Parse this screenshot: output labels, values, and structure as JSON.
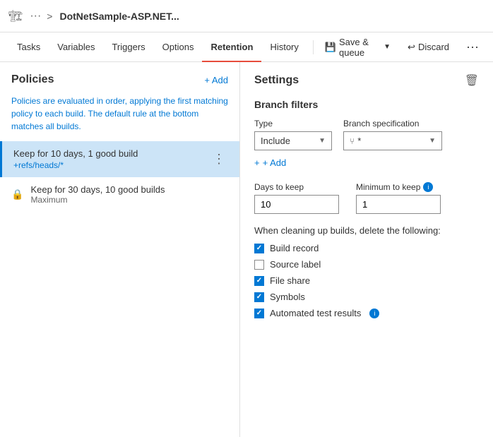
{
  "header": {
    "icon": "🏗",
    "dots": "···",
    "arrow": ">",
    "title": "DotNetSample-ASP.NET..."
  },
  "nav": {
    "items": [
      {
        "id": "tasks",
        "label": "Tasks",
        "active": false
      },
      {
        "id": "variables",
        "label": "Variables",
        "active": false
      },
      {
        "id": "triggers",
        "label": "Triggers",
        "active": false
      },
      {
        "id": "options",
        "label": "Options",
        "active": false
      },
      {
        "id": "retention",
        "label": "Retention",
        "active": true
      },
      {
        "id": "history",
        "label": "History",
        "active": false
      }
    ],
    "save_label": "Save & queue",
    "discard_label": "Discard"
  },
  "left_panel": {
    "title": "Policies",
    "add_label": "+ Add",
    "description": "Policies are evaluated in order, applying the first matching policy to each build. The default rule at the bottom matches all builds.",
    "policies": [
      {
        "id": "policy1",
        "name": "Keep for 10 days, 1 good build",
        "sub": "+refs/heads/*",
        "selected": true,
        "locked": false
      }
    ],
    "locked_policies": [
      {
        "id": "policy2",
        "name": "Keep for 30 days, 10 good builds",
        "sub": "Maximum",
        "locked": true
      }
    ]
  },
  "right_panel": {
    "title": "Settings",
    "branch_filters": {
      "section_title": "Branch filters",
      "type_label": "Type",
      "type_value": "Include",
      "branch_spec_label": "Branch specification",
      "branch_spec_value": "*",
      "add_label": "+ Add"
    },
    "days_to_keep": {
      "label": "Days to keep",
      "value": "10"
    },
    "minimum_to_keep": {
      "label": "Minimum to keep",
      "value": "1"
    },
    "cleanup": {
      "title": "When cleaning up builds, delete the following:",
      "items": [
        {
          "id": "build-record",
          "label": "Build record",
          "checked": true
        },
        {
          "id": "source-label",
          "label": "Source label",
          "checked": false
        },
        {
          "id": "file-share",
          "label": "File share",
          "checked": true
        },
        {
          "id": "symbols",
          "label": "Symbols",
          "checked": true
        },
        {
          "id": "automated-test-results",
          "label": "Automated test results",
          "checked": true,
          "has_info": true
        }
      ]
    }
  }
}
